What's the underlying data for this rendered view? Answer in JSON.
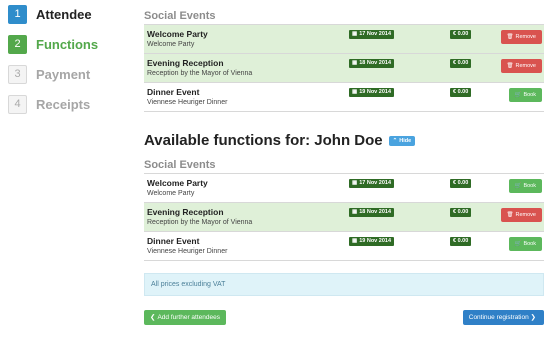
{
  "steps": [
    {
      "number": "1",
      "label": "Attendee"
    },
    {
      "number": "2",
      "label": "Functions"
    },
    {
      "number": "3",
      "label": "Payment"
    },
    {
      "number": "4",
      "label": "Receipts"
    }
  ],
  "booked": {
    "section": "Social Events",
    "rows": [
      {
        "name": "Welcome Party",
        "desc": "Welcome Party",
        "date": "17 Nov 2014",
        "price": "€ 0.00",
        "action": "Remove"
      },
      {
        "name": "Evening Reception",
        "desc": "Reception by the Mayor of Vienna",
        "date": "18 Nov 2014",
        "price": "€ 0.00",
        "action": "Remove"
      },
      {
        "name": "Dinner Event",
        "desc": "Viennese Heuriger Dinner",
        "date": "19 Nov 2014",
        "price": "€ 0.00",
        "action": "Book"
      }
    ]
  },
  "available": {
    "title": "Available functions for: John Doe",
    "hide_label": "Hide",
    "section": "Social Events",
    "rows": [
      {
        "name": "Welcome Party",
        "desc": "Welcome Party",
        "date": "17 Nov 2014",
        "price": "€ 0.00",
        "action": "Book"
      },
      {
        "name": "Evening Reception",
        "desc": "Reception by the Mayor of Vienna",
        "date": "18 Nov 2014",
        "price": "€ 0.00",
        "action": "Remove"
      },
      {
        "name": "Dinner Event",
        "desc": "Viennese Heuriger Dinner",
        "date": "19 Nov 2014",
        "price": "€ 0.00",
        "action": "Book"
      }
    ]
  },
  "info": "All prices excluding VAT",
  "buttons": {
    "add": "Add further attendees",
    "continue": "Continue registration"
  },
  "icons": {
    "calendar": "calendar-icon",
    "trash": "trash-icon",
    "cart": "cart-icon",
    "chevron-left": "chevron-left-icon",
    "chevron-right": "chevron-right-icon",
    "chevron-up": "chevron-up-icon"
  },
  "colors": {
    "active_step": "#2f8dcb",
    "done_step": "#53a84b",
    "booked_row": "#dff0d8",
    "remove": "#d9534f",
    "book": "#5cb85c",
    "continue": "#2f80c7"
  }
}
